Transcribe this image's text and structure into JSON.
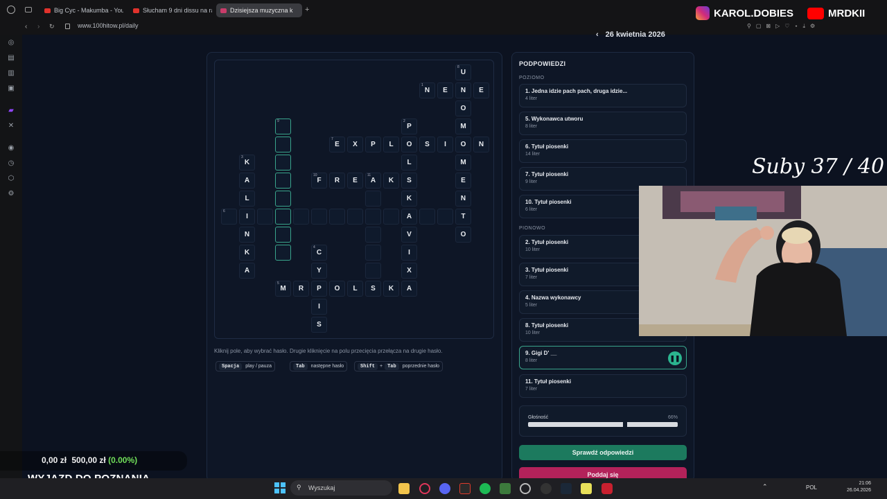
{
  "browser": {
    "tabs": [
      {
        "label": "Big Cyc - Makumba - YouT"
      },
      {
        "label": "Słucham 9 dni dissu na ra"
      },
      {
        "label": "Dzisiejsza muzyczna k"
      }
    ],
    "url": "www.100hitow.pl/daily"
  },
  "header": {
    "date": "26 kwietnia 2026"
  },
  "crossword": {
    "hint": "Kliknij pole, aby wybrać hasło. Drugie kliknięcie na polu przecięcia przełącza na drugie hasło.",
    "shortcuts": [
      {
        "keys": [
          "Spacja"
        ],
        "plus": "",
        "action": "play / pauza"
      },
      {
        "keys": [
          "Tab"
        ],
        "plus": "",
        "action": "następne hasło"
      },
      {
        "keys": [
          "Shift",
          "Tab"
        ],
        "plus": "+",
        "action": "poprzednie hasło"
      }
    ],
    "cells": [
      {
        "r": 0,
        "c": 13,
        "ch": "U",
        "n": "8"
      },
      {
        "r": 1,
        "c": 11,
        "ch": "N",
        "n": "1"
      },
      {
        "r": 1,
        "c": 12,
        "ch": "E"
      },
      {
        "r": 1,
        "c": 13,
        "ch": "N"
      },
      {
        "r": 1,
        "c": 14,
        "ch": "E"
      },
      {
        "r": 2,
        "c": 13,
        "ch": "O"
      },
      {
        "r": 3,
        "c": 3,
        "ch": "",
        "n": "9",
        "sel": true
      },
      {
        "r": 3,
        "c": 10,
        "ch": "P",
        "n": "2"
      },
      {
        "r": 3,
        "c": 13,
        "ch": "M"
      },
      {
        "r": 4,
        "c": 3,
        "ch": "",
        "sel": true
      },
      {
        "r": 4,
        "c": 6,
        "ch": "E",
        "n": "7"
      },
      {
        "r": 4,
        "c": 7,
        "ch": "X"
      },
      {
        "r": 4,
        "c": 8,
        "ch": "P"
      },
      {
        "r": 4,
        "c": 9,
        "ch": "L"
      },
      {
        "r": 4,
        "c": 10,
        "ch": "O"
      },
      {
        "r": 4,
        "c": 11,
        "ch": "S"
      },
      {
        "r": 4,
        "c": 12,
        "ch": "I"
      },
      {
        "r": 4,
        "c": 13,
        "ch": "O"
      },
      {
        "r": 4,
        "c": 14,
        "ch": "N"
      },
      {
        "r": 5,
        "c": 1,
        "ch": "K",
        "n": "3"
      },
      {
        "r": 5,
        "c": 3,
        "ch": "",
        "sel": true
      },
      {
        "r": 5,
        "c": 10,
        "ch": "L"
      },
      {
        "r": 5,
        "c": 13,
        "ch": "M"
      },
      {
        "r": 6,
        "c": 1,
        "ch": "A"
      },
      {
        "r": 6,
        "c": 3,
        "ch": "",
        "sel": true
      },
      {
        "r": 6,
        "c": 5,
        "ch": "F",
        "n": "10"
      },
      {
        "r": 6,
        "c": 6,
        "ch": "R"
      },
      {
        "r": 6,
        "c": 7,
        "ch": "E"
      },
      {
        "r": 6,
        "c": 8,
        "ch": "A",
        "n": "11"
      },
      {
        "r": 6,
        "c": 9,
        "ch": "K"
      },
      {
        "r": 6,
        "c": 10,
        "ch": "S"
      },
      {
        "r": 6,
        "c": 13,
        "ch": "E"
      },
      {
        "r": 7,
        "c": 1,
        "ch": "L"
      },
      {
        "r": 7,
        "c": 3,
        "ch": "",
        "sel": true
      },
      {
        "r": 7,
        "c": 8,
        "ch": ""
      },
      {
        "r": 7,
        "c": 10,
        "ch": "K"
      },
      {
        "r": 7,
        "c": 13,
        "ch": "N"
      },
      {
        "r": 8,
        "c": 0,
        "ch": "",
        "n": "6"
      },
      {
        "r": 8,
        "c": 1,
        "ch": "I"
      },
      {
        "r": 8,
        "c": 2,
        "ch": ""
      },
      {
        "r": 8,
        "c": 3,
        "ch": "",
        "sel": true
      },
      {
        "r": 8,
        "c": 4,
        "ch": ""
      },
      {
        "r": 8,
        "c": 5,
        "ch": ""
      },
      {
        "r": 8,
        "c": 6,
        "ch": ""
      },
      {
        "r": 8,
        "c": 7,
        "ch": ""
      },
      {
        "r": 8,
        "c": 8,
        "ch": ""
      },
      {
        "r": 8,
        "c": 9,
        "ch": ""
      },
      {
        "r": 8,
        "c": 10,
        "ch": "A"
      },
      {
        "r": 8,
        "c": 11,
        "ch": ""
      },
      {
        "r": 8,
        "c": 12,
        "ch": ""
      },
      {
        "r": 8,
        "c": 13,
        "ch": "T"
      },
      {
        "r": 9,
        "c": 1,
        "ch": "N"
      },
      {
        "r": 9,
        "c": 3,
        "ch": "",
        "sel": true
      },
      {
        "r": 9,
        "c": 8,
        "ch": ""
      },
      {
        "r": 9,
        "c": 10,
        "ch": "V"
      },
      {
        "r": 9,
        "c": 13,
        "ch": "O"
      },
      {
        "r": 10,
        "c": 1,
        "ch": "K"
      },
      {
        "r": 10,
        "c": 3,
        "ch": "",
        "sel": true
      },
      {
        "r": 10,
        "c": 5,
        "ch": "C",
        "n": "4"
      },
      {
        "r": 10,
        "c": 8,
        "ch": ""
      },
      {
        "r": 10,
        "c": 10,
        "ch": "I"
      },
      {
        "r": 11,
        "c": 1,
        "ch": "A"
      },
      {
        "r": 11,
        "c": 5,
        "ch": "Y"
      },
      {
        "r": 11,
        "c": 8,
        "ch": ""
      },
      {
        "r": 11,
        "c": 10,
        "ch": "X"
      },
      {
        "r": 12,
        "c": 3,
        "ch": "M",
        "n": "5"
      },
      {
        "r": 12,
        "c": 4,
        "ch": "R"
      },
      {
        "r": 12,
        "c": 5,
        "ch": "P"
      },
      {
        "r": 12,
        "c": 6,
        "ch": "O"
      },
      {
        "r": 12,
        "c": 7,
        "ch": "L"
      },
      {
        "r": 12,
        "c": 8,
        "ch": "S"
      },
      {
        "r": 12,
        "c": 9,
        "ch": "K"
      },
      {
        "r": 12,
        "c": 10,
        "ch": "A"
      },
      {
        "r": 13,
        "c": 5,
        "ch": "I"
      },
      {
        "r": 14,
        "c": 5,
        "ch": "S"
      }
    ]
  },
  "clues": {
    "title": "PODPOWIEDZI",
    "across_label": "POZIOMO",
    "down_label": "PIONOWO",
    "across": [
      {
        "text": "1. Jedna idzie pach pach, druga idzie...",
        "sub": "4 liter"
      },
      {
        "text": "5. Wykonawca utworu",
        "sub": "8 liter"
      },
      {
        "text": "6. Tytuł piosenki",
        "sub": "14 liter"
      },
      {
        "text": "7. Tytuł piosenki",
        "sub": "9 liter"
      },
      {
        "text": "10. Tytuł piosenki",
        "sub": "6 liter"
      }
    ],
    "down": [
      {
        "text": "2. Tytuł piosenki",
        "sub": "10 liter"
      },
      {
        "text": "3. Tytuł piosenki",
        "sub": "7 liter"
      },
      {
        "text": "4. Nazwa wykonawcy",
        "sub": "5 liter"
      },
      {
        "text": "8. Tytuł piosenki",
        "sub": "10 liter"
      },
      {
        "text": "9. Gigi D' __",
        "sub": "8 liter"
      },
      {
        "text": "11. Tytuł piosenki",
        "sub": "7 liter"
      }
    ],
    "volume_label": "Głośność",
    "volume_value": "66%",
    "volume_level": 0.66,
    "check_button": "Sprawdź odpowiedzi",
    "giveup_button": "Poddaj się"
  },
  "overlay": {
    "suby": "Suby 37 / 40",
    "instagram": "KAROL.DOBIES",
    "youtube": "MRDKII",
    "money_left": "0,00 zł",
    "money_right": "500,00 zł",
    "money_pct": "(0.00%)",
    "banner": "WYJAZD DO POZNANIA"
  },
  "taskbar": {
    "search_placeholder": "Wyszukaj",
    "lang": "POL",
    "time": "21:06",
    "date": "26.04.2026"
  },
  "colors": {
    "accent": "#2bb58f",
    "danger": "#b3225a",
    "bg": "#0c1220"
  }
}
